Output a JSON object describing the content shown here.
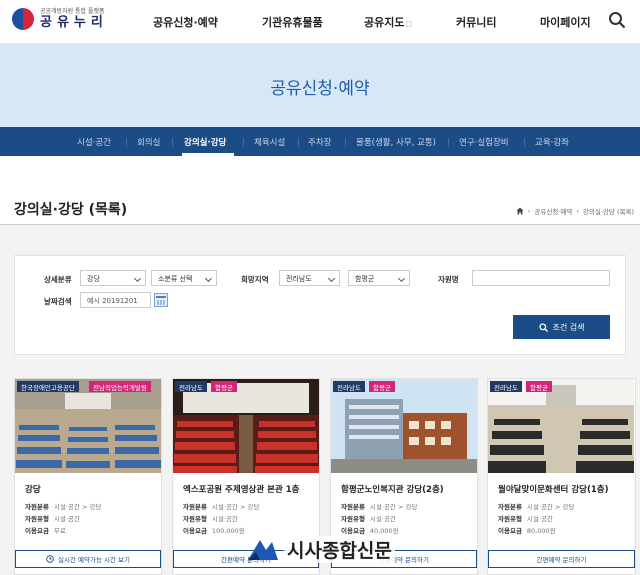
{
  "header": {
    "logo_sub": "공공개방자원 통합 플랫폼",
    "logo_name": "공유누리",
    "nav": [
      "공유신청·예약",
      "기관유휴물품",
      "공유지도",
      "커뮤니티",
      "마이페이지"
    ]
  },
  "banner": {
    "title": "공유신청·예약"
  },
  "subnav": [
    "시설·공간",
    "회의실",
    "강의실·강당",
    "체육시설",
    "주차장",
    "물품(생활, 사무, 교통)",
    "연구·실험장비",
    "교육·강좌"
  ],
  "page": {
    "title": "강의실·강당 (목록)",
    "breadcrumb": [
      "공유신청·예약",
      "강의실·강당 (목록)"
    ]
  },
  "filters": {
    "category_label": "상세분류",
    "category_value": "강당",
    "subcategory_value": "소분류 선택",
    "region_label": "희망지역",
    "region_province": "전라남도",
    "region_county": "함평군",
    "name_label": "자원명",
    "name_value": "",
    "date_label": "날짜검색",
    "date_placeholder": "예시 20191201",
    "search_button": "조건 검색"
  },
  "cards": [
    {
      "tag_region": "한국장애인고용공단",
      "tag_org": "전남직업능력개발원",
      "title": "강당",
      "category": "시설·공간 > 강당",
      "type": "시설·공간",
      "fee": "무료",
      "button": "실시간 예약가능 시간 보기",
      "button_icon": "clock-icon"
    },
    {
      "tag_region": "전라남도",
      "tag_org": "함평군",
      "title": "엑스포공원 주제영상관 본관 1층",
      "category": "시설·공간 > 강당",
      "type": "시설·공간",
      "fee": "100,000원",
      "button": "간편예약 문의하기",
      "button_icon": ""
    },
    {
      "tag_region": "전라남도",
      "tag_org": "함평군",
      "title": "함평군노인복지관 강당(2층)",
      "category": "시설·공간 > 강당",
      "type": "시설·공간",
      "fee": "40,000원",
      "button": "간편예약 문의하기",
      "button_icon": ""
    },
    {
      "tag_region": "전라남도",
      "tag_org": "함평군",
      "title": "월야달맞이문화센터 강당(1층)",
      "category": "시설·공간 > 강당",
      "type": "시설·공간",
      "fee": "80,000원",
      "button": "간편예약 문의하기",
      "button_icon": ""
    }
  ],
  "card_labels": {
    "category": "자원분류",
    "type": "자원유형",
    "fee": "이용요금"
  },
  "watermark": "시사종합신문",
  "colors": {
    "primary": "#1b4c86",
    "banner": "#d7e7f6",
    "tag_dark": "#1f3a64",
    "tag_pink": "#d1267a"
  }
}
